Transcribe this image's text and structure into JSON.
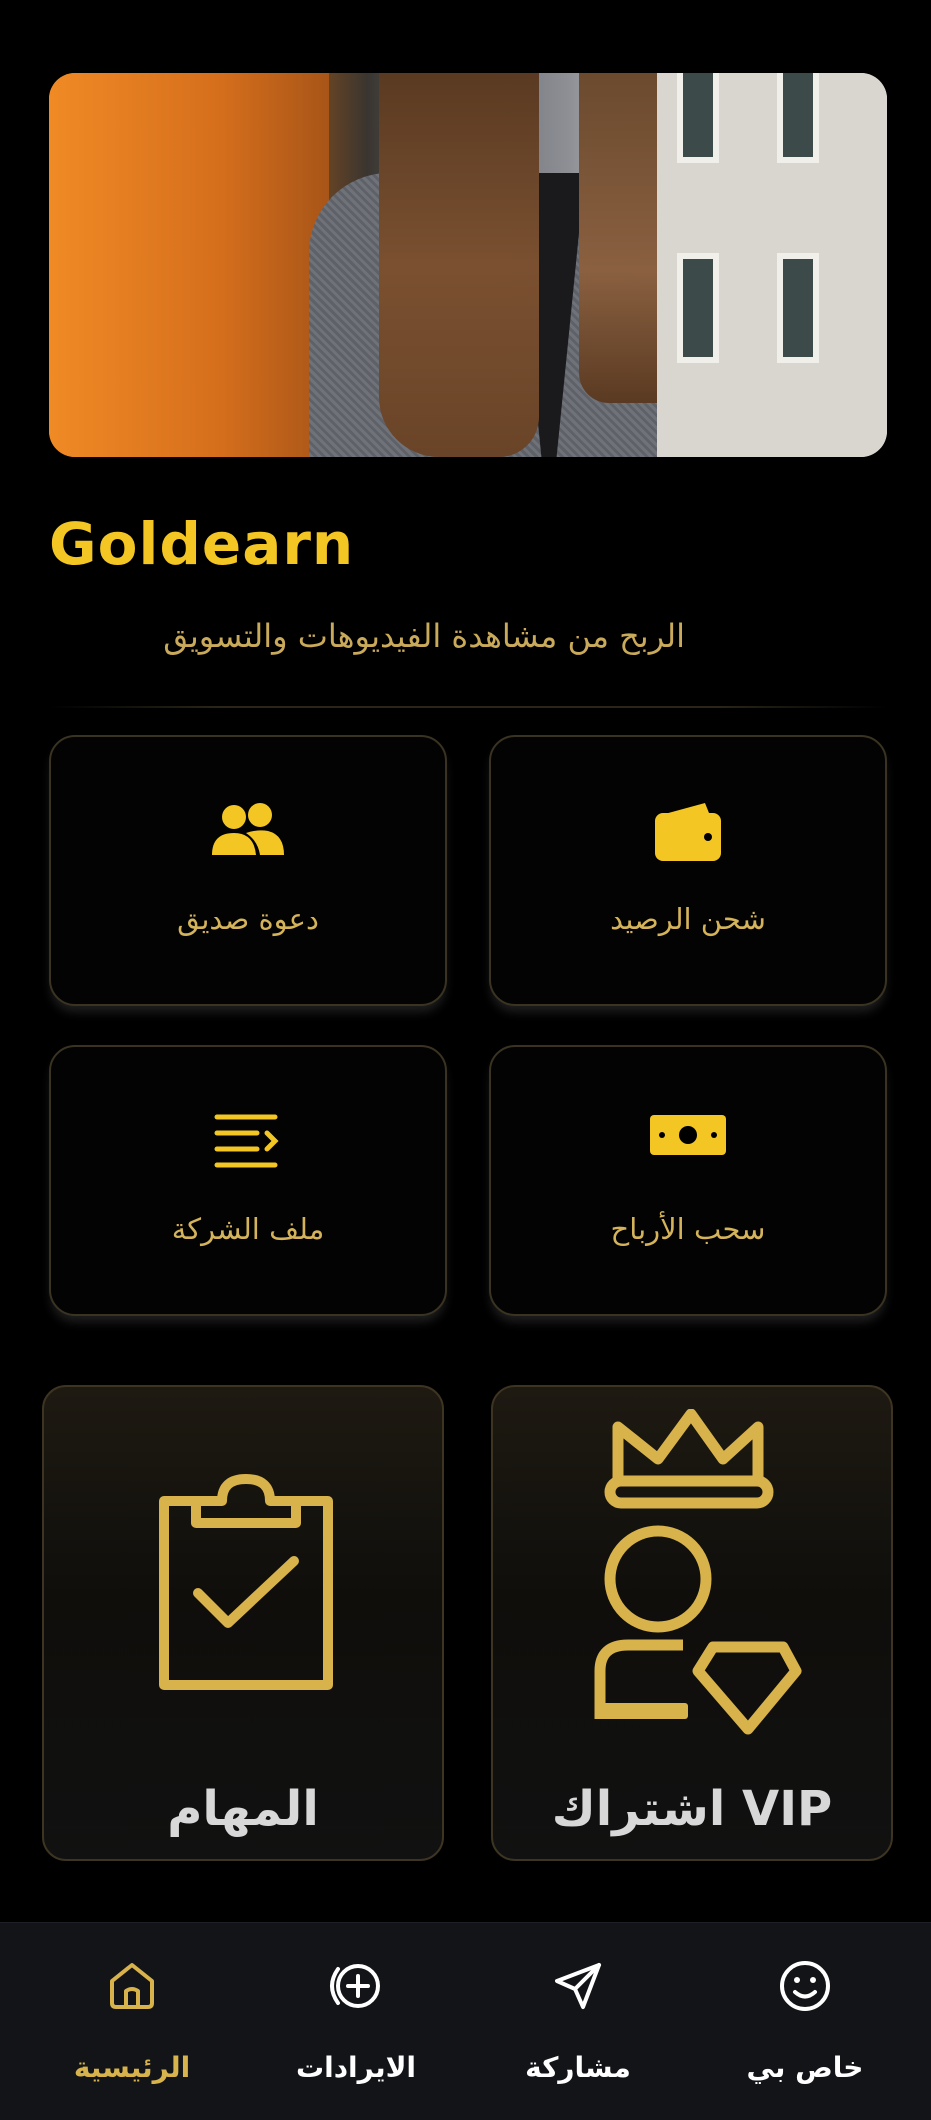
{
  "app": {
    "title": "Goldearn",
    "subtitle": "الربح من مشاهدة الفيديوهات والتسويق"
  },
  "banner": {
    "image": "promotional-photo-woman-in-blazer"
  },
  "actions": [
    {
      "id": "recharge",
      "label": "شحن الرصيد",
      "icon": "wallet-icon"
    },
    {
      "id": "invite",
      "label": "دعوة صديق",
      "icon": "users-icon"
    },
    {
      "id": "withdraw",
      "label": "سحب الأرباح",
      "icon": "cash-icon"
    },
    {
      "id": "company",
      "label": "ملف الشركة",
      "icon": "document-list-icon"
    }
  ],
  "features": [
    {
      "id": "vip",
      "label": "اشتراك VIP",
      "icon": "vip-crown-user-icon"
    },
    {
      "id": "tasks",
      "label": "المهام",
      "icon": "clipboard-check-icon"
    }
  ],
  "nav": [
    {
      "id": "profile",
      "label": "خاص بي",
      "icon": "smiley-icon",
      "active": false
    },
    {
      "id": "share",
      "label": "مشاركة",
      "icon": "send-icon",
      "active": false
    },
    {
      "id": "revenue",
      "label": "الايرادات",
      "icon": "plus-circle-icon",
      "active": false
    },
    {
      "id": "home",
      "label": "الرئيسية",
      "icon": "home-icon",
      "active": true
    }
  ],
  "colors": {
    "accent": "#f3c623",
    "gold_text": "#d4b35a",
    "background": "#000000",
    "nav_bg": "#121418"
  }
}
